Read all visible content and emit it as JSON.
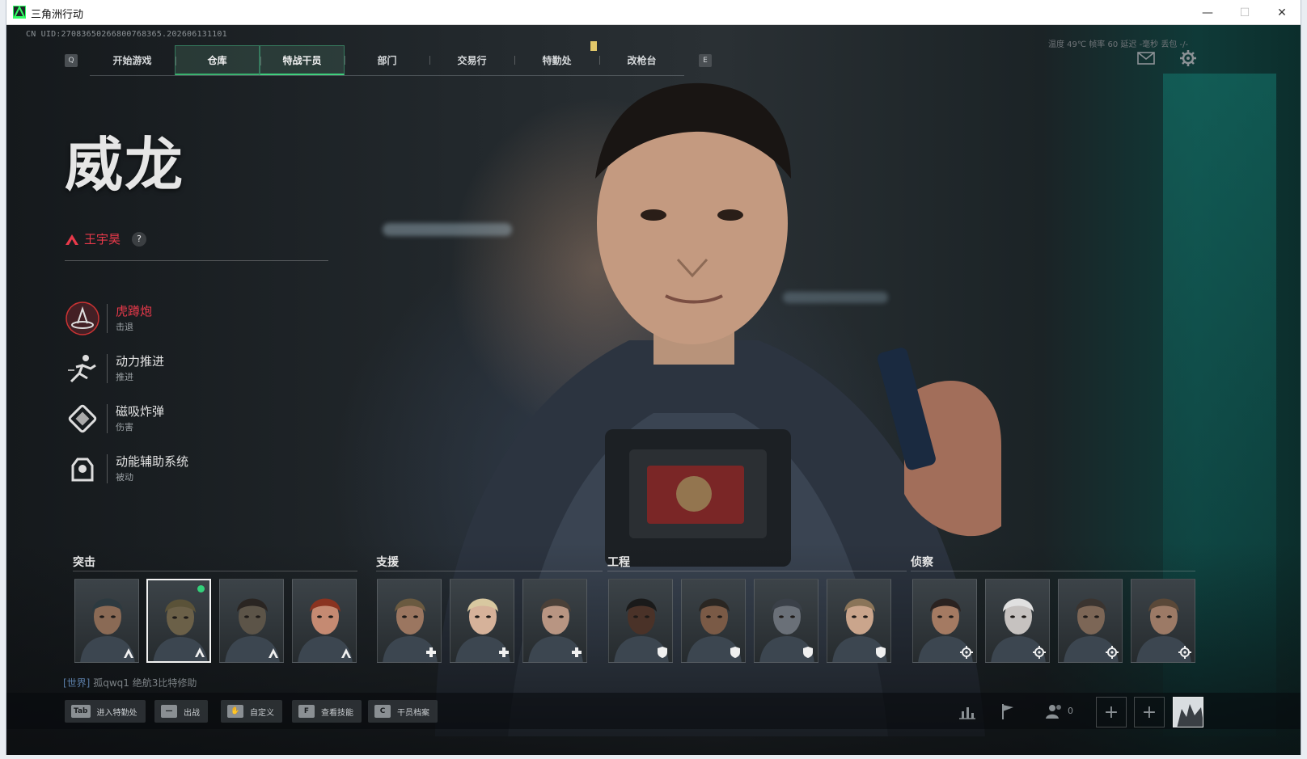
{
  "window": {
    "title": "三角洲行动",
    "minimize": "—",
    "maximize": "☐",
    "close": "✕"
  },
  "hud": {
    "uid": "CN UID:27083650266800768365.202606131101",
    "key_prev": "Q",
    "key_next": "E",
    "stats": "温度 49℃   帧率 60    延迟 -毫秒    丢包 -/-"
  },
  "nav": {
    "tabs": [
      {
        "label": "开始游戏"
      },
      {
        "label": "仓库"
      },
      {
        "label": "特战干员"
      },
      {
        "label": "部门"
      },
      {
        "label": "交易行"
      },
      {
        "label": "特勤处"
      },
      {
        "label": "改枪台"
      }
    ],
    "selected_index": 2
  },
  "operator": {
    "name": "威龙",
    "actor": "王宇昊",
    "help": "?",
    "skills": [
      {
        "name": "虎蹲炮",
        "type": "击退",
        "icon": "mortar-icon"
      },
      {
        "name": "动力推进",
        "type": "推进",
        "icon": "dash-icon"
      },
      {
        "name": "磁吸炸弹",
        "type": "伤害",
        "icon": "magnet-bomb-icon"
      },
      {
        "name": "动能辅助系统",
        "type": "被动",
        "icon": "exo-system-icon"
      }
    ]
  },
  "roster": {
    "groups": [
      {
        "label": "突击",
        "badge": "assault-chevron-icon",
        "count": 4
      },
      {
        "label": "支援",
        "badge": "support-cross-icon",
        "count": 3
      },
      {
        "label": "工程",
        "badge": "engineer-shield-icon",
        "count": 4
      },
      {
        "label": "侦察",
        "badge": "recon-target-icon",
        "count": 4
      }
    ],
    "selected_card": 1
  },
  "chat": {
    "channel": "[世界]",
    "message": "孤qwq1  绝航3比特修助"
  },
  "hints": [
    {
      "key": "Tab",
      "label": "进入特勤处"
    },
    {
      "key": "—",
      "label": "出战"
    },
    {
      "key": "✋",
      "label": "自定义"
    },
    {
      "key": "F",
      "label": "查看技能"
    },
    {
      "key": "C",
      "label": "干员档案"
    }
  ],
  "party": {
    "count": "0",
    "add_slot": "+"
  },
  "colors": {
    "accent_green": "#3fd07d",
    "accent_red": "#e8394a",
    "teal": "#0f3a38"
  }
}
